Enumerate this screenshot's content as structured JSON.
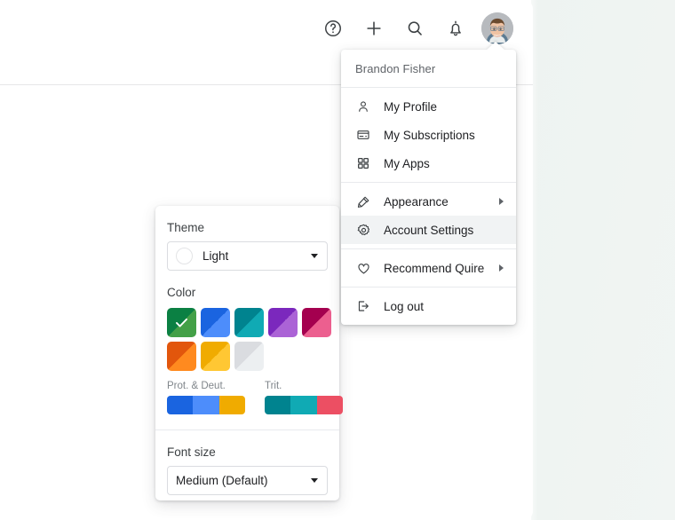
{
  "toolbar": {
    "items": [
      {
        "name": "help-icon",
        "label": "Help"
      },
      {
        "name": "add-icon",
        "label": "Create"
      },
      {
        "name": "search-icon",
        "label": "Search"
      },
      {
        "name": "notifications-bell-icon",
        "label": "Notifications"
      }
    ],
    "avatar_alt": "Brandon Fisher"
  },
  "account_menu": {
    "user_name": "Brandon Fisher",
    "group_1": [
      {
        "icon": "person-icon",
        "label": "My Profile",
        "submenu": false,
        "selected": false
      },
      {
        "icon": "credit-card-icon",
        "label": "My Subscriptions",
        "submenu": false,
        "selected": false
      },
      {
        "icon": "apps-grid-icon",
        "label": "My Apps",
        "submenu": false,
        "selected": false
      }
    ],
    "group_2": [
      {
        "icon": "paint-roller-icon",
        "label": "Appearance",
        "submenu": true,
        "selected": false
      },
      {
        "icon": "gear-icon",
        "label": "Account Settings",
        "submenu": false,
        "selected": true
      }
    ],
    "group_3": [
      {
        "icon": "heart-icon",
        "label": "Recommend Quire",
        "submenu": true,
        "selected": false
      }
    ],
    "group_4": [
      {
        "icon": "logout-icon",
        "label": "Log out",
        "submenu": false,
        "selected": false
      }
    ]
  },
  "appearance_panel": {
    "theme_label": "Theme",
    "theme_value": "Light",
    "color_label": "Color",
    "swatches": [
      {
        "name": "green",
        "dark": "#0b8043",
        "light": "#43a047",
        "selected": true
      },
      {
        "name": "blue",
        "dark": "#1a64e0",
        "light": "#4d8dfb",
        "selected": false
      },
      {
        "name": "teal",
        "dark": "#00838f",
        "light": "#10aab4",
        "selected": false
      },
      {
        "name": "purple",
        "dark": "#7b28bd",
        "light": "#ab63d6",
        "selected": false
      },
      {
        "name": "magenta",
        "dark": "#a4004f",
        "light": "#ec5f8f",
        "selected": false
      },
      {
        "name": "orange",
        "dark": "#e2560c",
        "light": "#ff8a1f",
        "selected": false
      },
      {
        "name": "amber",
        "dark": "#f0ab00",
        "light": "#ffc733",
        "selected": false
      },
      {
        "name": "grey",
        "dark": "#dadce0",
        "light": "#eceff1",
        "selected": false
      }
    ],
    "colorblind": [
      {
        "caption": "Prot. & Deut.",
        "name": "protanopia-deuteranopia-palette",
        "colors": [
          "#1a64e0",
          "#4d8dfb",
          "#f0ab00"
        ]
      },
      {
        "caption": "Trit.",
        "name": "tritanopia-palette",
        "colors": [
          "#00838f",
          "#10aab4",
          "#ec4f63"
        ]
      }
    ],
    "font_size_label": "Font size",
    "font_size_value": "Medium (Default)"
  }
}
